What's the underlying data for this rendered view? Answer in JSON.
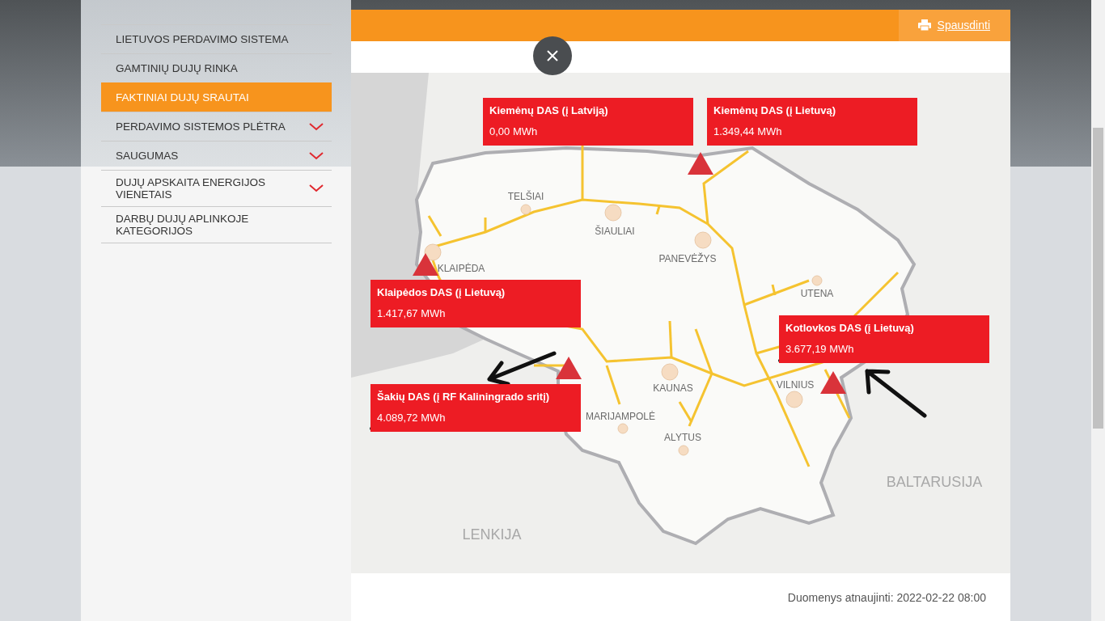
{
  "menu": [
    {
      "label": "LIETUVOS PERDAVIMO SISTEMA",
      "selected": false,
      "kind": "link"
    },
    {
      "label": "GAMTINIŲ DUJŲ RINKA",
      "selected": false,
      "kind": "link"
    },
    {
      "label": "FAKTINIAI DUJŲ SRAUTAI",
      "selected": true,
      "kind": "link"
    },
    {
      "label": "PERDAVIMO SISTEMOS PLĖTRA",
      "selected": false,
      "kind": "submenu"
    },
    {
      "label": "SAUGUMAS",
      "selected": false,
      "kind": "submenu"
    },
    {
      "label": "DUJŲ APSKAITA ENERGIJOS VIENETAIS",
      "selected": false,
      "kind": "submenu"
    },
    {
      "label": "DARBŲ DUJŲ APLINKOJE KATEGORIJOS",
      "selected": false,
      "kind": "link"
    }
  ],
  "print_link": "Spausdinti",
  "map": {
    "cities": [
      "TELŠIAI",
      "ŠIAULIAI",
      "PANEVĖŽYS",
      "KLAIPĖDA",
      "UTENA",
      "KAUNAS",
      "VILNIUS",
      "MARIJAMPOLĖ",
      "ALYTUS"
    ],
    "countries": [
      "LENKIJA",
      "BALTARUSIJA"
    ],
    "stations": [
      {
        "name": "Kiemėnų DAS (į Latviją)",
        "value": "0,00 MWh",
        "highlighted": false
      },
      {
        "name": "Kiemėnų DAS (į Lietuvą)",
        "value": "1.349,44 MWh",
        "highlighted": false
      },
      {
        "name": "Klaipėdos DAS (į Lietuvą)",
        "value": "1.417,67 MWh",
        "highlighted": false
      },
      {
        "name": "Kotlovkos DAS (į Lietuvą)",
        "value": "3.677,19 MWh",
        "highlighted": true
      },
      {
        "name": "Šakių DAS (į RF Kaliningrado sritį)",
        "value": "4.089,72 MWh",
        "highlighted": true
      }
    ]
  },
  "updated": "Duomenys atnaujinti: 2022-02-22 08:00"
}
